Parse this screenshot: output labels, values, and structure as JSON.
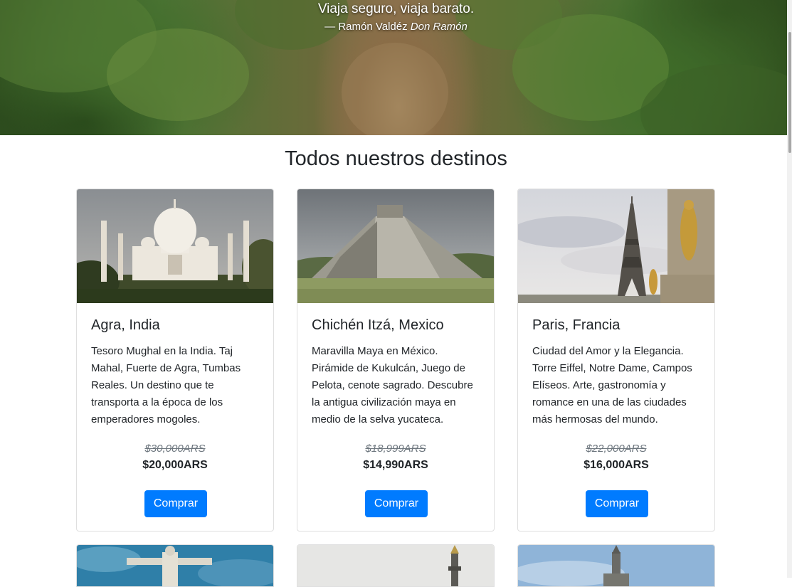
{
  "hero": {
    "quote": "Viaja seguro, viaja barato.",
    "author_prefix": "— Ramón Valdéz ",
    "author_alias": "Don Ramón"
  },
  "section": {
    "title": "Todos nuestros destinos"
  },
  "destinations": [
    {
      "title": "Agra, India",
      "description": "Tesoro Mughal en la India. Taj Mahal, Fuerte de Agra, Tumbas Reales. Un destino que te transporta a la época de los emperadores mogoles.",
      "old_price": "$30,000ARS",
      "price": "$20,000ARS",
      "button": "Comprar",
      "image_icon": "taj-mahal-photo"
    },
    {
      "title": "Chichén Itzá, Mexico",
      "description": "Maravilla Maya en México. Pirámide de Kukulcán, Juego de Pelota, cenote sagrado. Descubre la antigua civilización maya en medio de la selva yucateca.",
      "old_price": "$18,999ARS",
      "price": "$14,990ARS",
      "button": "Comprar",
      "image_icon": "pyramid-photo"
    },
    {
      "title": "Paris, Francia",
      "description": "Ciudad del Amor y la Elegancia. Torre Eiffel, Notre Dame, Campos Elíseos. Arte, gastronomía y romance en una de las ciudades más hermosas del mundo.",
      "old_price": "$22,000ARS",
      "price": "$16,000ARS",
      "button": "Comprar",
      "image_icon": "eiffel-tower-photo"
    }
  ],
  "colors": {
    "primary": "#007bff",
    "text": "#212529",
    "muted": "#6c757d"
  }
}
